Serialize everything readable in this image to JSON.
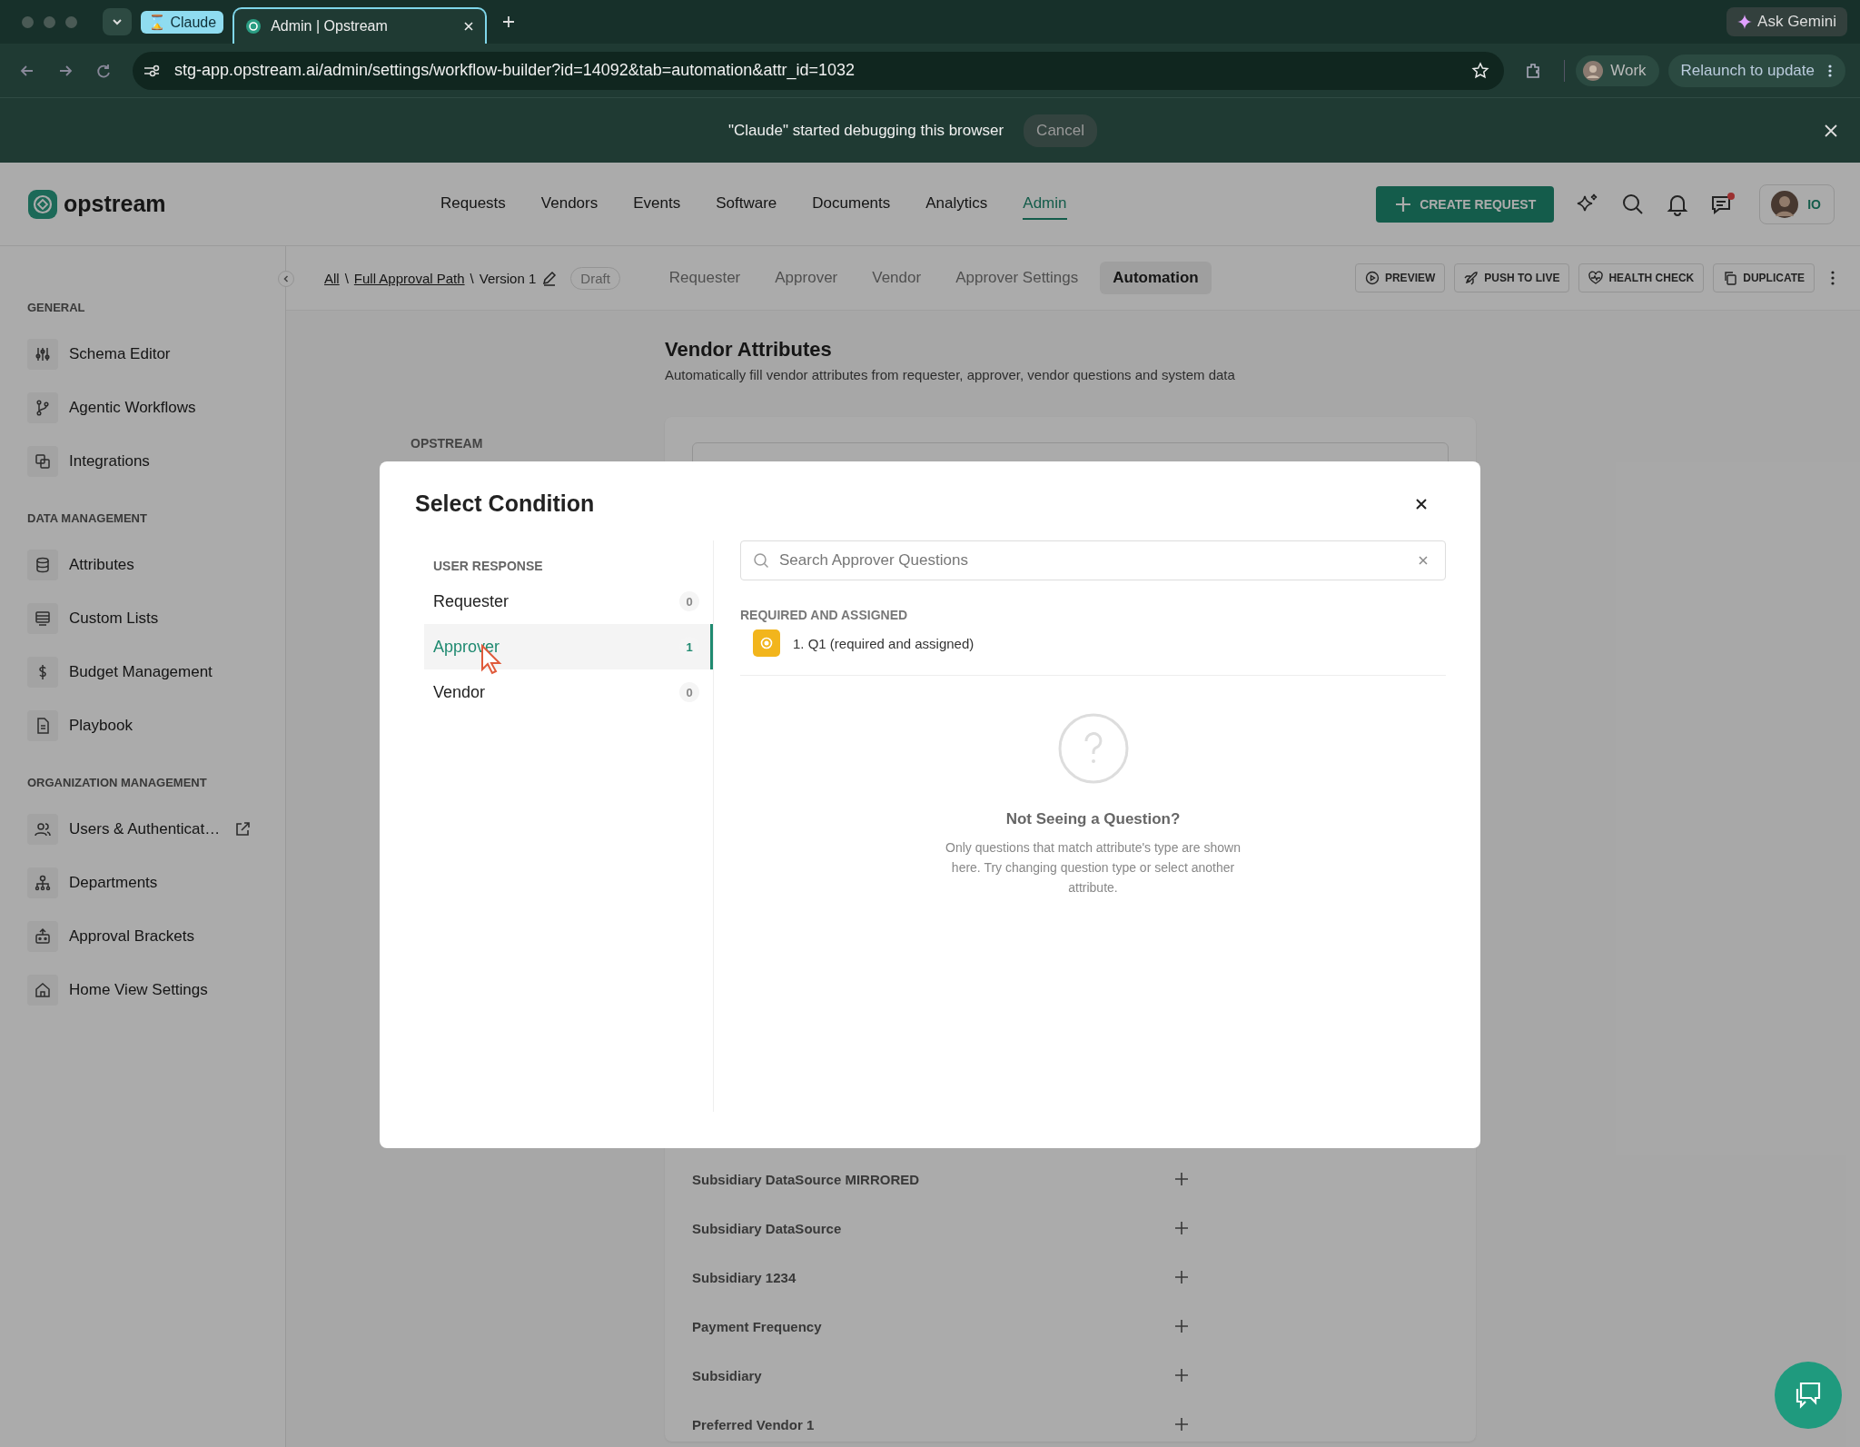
{
  "browser": {
    "tab_group": "⌛ Claude",
    "tabs": [
      {
        "title": "Admin | Opstream",
        "selected": true
      }
    ],
    "url": "stg-app.opstream.ai/admin/settings/workflow-builder?id=14092&tab=automation&attr_id=1032",
    "profile": "Work",
    "update_button": "Relaunch to update",
    "gemini_button": "Ask Gemini",
    "debug_banner": {
      "message": "\"Claude\" started debugging this browser",
      "cancel": "Cancel"
    }
  },
  "header": {
    "logo": "opstream",
    "nav": [
      {
        "label": "Requests",
        "selected": false
      },
      {
        "label": "Vendors",
        "selected": false
      },
      {
        "label": "Events",
        "selected": false
      },
      {
        "label": "Software",
        "selected": false
      },
      {
        "label": "Documents",
        "selected": false
      },
      {
        "label": "Analytics",
        "selected": false
      },
      {
        "label": "Admin",
        "selected": true
      }
    ],
    "create_button": "CREATE REQUEST",
    "messages_unread": true,
    "org_badge": "IO"
  },
  "sidebar": {
    "sections": [
      {
        "title": "GENERAL",
        "items": [
          {
            "label": "Schema Editor",
            "external": false
          },
          {
            "label": "Agentic Workflows",
            "external": false
          },
          {
            "label": "Integrations",
            "external": false
          }
        ]
      },
      {
        "title": "DATA MANAGEMENT",
        "items": [
          {
            "label": "Attributes",
            "external": false
          },
          {
            "label": "Custom Lists",
            "external": false
          },
          {
            "label": "Budget Management",
            "external": false
          },
          {
            "label": "Playbook",
            "external": false
          }
        ]
      },
      {
        "title": "ORGANIZATION MANAGEMENT",
        "items": [
          {
            "label": "Users & Authenticat…",
            "external": true
          },
          {
            "label": "Departments",
            "external": false
          },
          {
            "label": "Approval Brackets",
            "external": false
          },
          {
            "label": "Home View Settings",
            "external": false
          }
        ]
      }
    ]
  },
  "subnav": {
    "breadcrumb": [
      {
        "label": "All",
        "link": true
      },
      {
        "label": "Full Approval Path",
        "link": true
      },
      {
        "label": "Version 1",
        "link": false
      }
    ],
    "separator": "\\",
    "status": "Draft",
    "tabs": [
      {
        "label": "Requester",
        "selected": false
      },
      {
        "label": "Approver",
        "selected": false
      },
      {
        "label": "Vendor",
        "selected": false
      },
      {
        "label": "Approver Settings",
        "selected": false
      },
      {
        "label": "Automation",
        "selected": true
      }
    ],
    "actions": [
      "PREVIEW",
      "PUSH TO LIVE",
      "HEALTH CHECK",
      "DUPLICATE"
    ]
  },
  "page": {
    "title": "Vendor Attributes",
    "subtitle": "Automatically fill vendor attributes from requester, approver, vendor questions and system data",
    "side_label": "OPSTREAM",
    "attributes": [
      "Subsidiary DataSource MIRRORED",
      "Subsidiary DataSource",
      "Subsidiary 1234",
      "Payment Frequency",
      "Subsidiary",
      "Preferred Vendor 1"
    ]
  },
  "modal": {
    "title": "Select Condition",
    "section_label": "USER RESPONSE",
    "categories": [
      {
        "label": "Requester",
        "count": "0",
        "selected": false
      },
      {
        "label": "Approver",
        "count": "1",
        "selected": true
      },
      {
        "label": "Vendor",
        "count": "0",
        "selected": false
      }
    ],
    "search_placeholder": "Search Approver Questions",
    "group_label": "REQUIRED AND ASSIGNED",
    "questions": [
      {
        "label": "1. Q1 (required and assigned)"
      }
    ],
    "empty_title": "Not Seeing a Question?",
    "empty_text": "Only questions that match attribute's type are shown here. Try changing question type or select another attribute."
  }
}
